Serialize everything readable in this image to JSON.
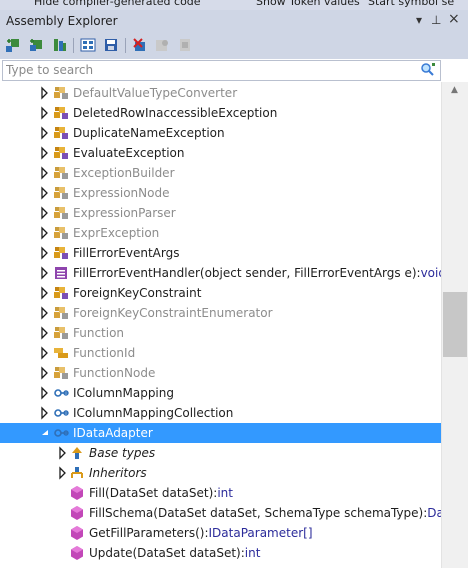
{
  "top_strip": {
    "items": [
      "Hide compiler-generated code",
      "Show Token values",
      "Start symbol se"
    ]
  },
  "window": {
    "title": "Assembly Explorer",
    "controls": {
      "dropdown": "▾",
      "pin": "⊥",
      "close": "×"
    }
  },
  "search": {
    "placeholder": "Type to search"
  },
  "colors": {
    "accent": "#3399ff",
    "titlebar": "#cfd6e5",
    "type_text": "#1e1e1e",
    "dim_text": "#8c8c8c",
    "return_type": "#2b2b9a"
  },
  "tree": {
    "rows": [
      {
        "label": "DefaultValueTypeConverter",
        "level": 0,
        "arrow": "collapsed",
        "icon": "class-gray-icon",
        "dim": true
      },
      {
        "label": "DeletedRowInaccessibleException",
        "level": 0,
        "arrow": "collapsed",
        "icon": "class-icon",
        "dim": false
      },
      {
        "label": "DuplicateNameException",
        "level": 0,
        "arrow": "collapsed",
        "icon": "class-icon",
        "dim": false
      },
      {
        "label": "EvaluateException",
        "level": 0,
        "arrow": "collapsed",
        "icon": "class-icon",
        "dim": false
      },
      {
        "label": "ExceptionBuilder",
        "level": 0,
        "arrow": "collapsed",
        "icon": "class-gray-icon",
        "dim": true
      },
      {
        "label": "ExpressionNode",
        "level": 0,
        "arrow": "collapsed",
        "icon": "class-gray-icon",
        "dim": true
      },
      {
        "label": "ExpressionParser",
        "level": 0,
        "arrow": "collapsed",
        "icon": "class-gray-icon",
        "dim": true
      },
      {
        "label": "ExprException",
        "level": 0,
        "arrow": "collapsed",
        "icon": "class-gray-icon",
        "dim": true
      },
      {
        "label": "FillErrorEventArgs",
        "level": 0,
        "arrow": "collapsed",
        "icon": "class-icon",
        "dim": false
      },
      {
        "label": "FillErrorEventHandler(object sender, FillErrorEventArgs e):",
        "ret": "void",
        "level": 0,
        "arrow": "collapsed",
        "icon": "delegate-icon",
        "dim": false
      },
      {
        "label": "ForeignKeyConstraint",
        "level": 0,
        "arrow": "collapsed",
        "icon": "class-icon",
        "dim": false
      },
      {
        "label": "ForeignKeyConstraintEnumerator",
        "level": 0,
        "arrow": "collapsed",
        "icon": "class-gray-icon",
        "dim": true
      },
      {
        "label": "Function",
        "level": 0,
        "arrow": "collapsed",
        "icon": "class-gray-icon",
        "dim": true
      },
      {
        "label": "FunctionId",
        "level": 0,
        "arrow": "collapsed",
        "icon": "enum-icon",
        "dim": true
      },
      {
        "label": "FunctionNode",
        "level": 0,
        "arrow": "collapsed",
        "icon": "class-gray-icon",
        "dim": true
      },
      {
        "label": "IColumnMapping",
        "level": 0,
        "arrow": "collapsed",
        "icon": "interface-icon",
        "dim": false
      },
      {
        "label": "IColumnMappingCollection",
        "level": 0,
        "arrow": "collapsed",
        "icon": "interface-icon",
        "dim": false
      },
      {
        "label": "IDataAdapter",
        "level": 0,
        "arrow": "expanded",
        "icon": "interface-icon",
        "dim": false,
        "selected": true
      },
      {
        "label": "Base types",
        "level": 1,
        "arrow": "collapsed",
        "icon": "base-types-icon",
        "dim": false,
        "italic": true
      },
      {
        "label": "Inheritors",
        "level": 1,
        "arrow": "collapsed",
        "icon": "inheritors-icon",
        "dim": false,
        "italic": true
      },
      {
        "label": "Fill(DataSet dataSet):",
        "ret": "int",
        "level": 2,
        "arrow": "none",
        "icon": "method-icon",
        "dim": false
      },
      {
        "label": "FillSchema(DataSet dataSet, SchemaType schemaType):",
        "ret": "DataTable[]",
        "level": 2,
        "arrow": "none",
        "icon": "method-icon",
        "dim": false
      },
      {
        "label": "GetFillParameters():",
        "ret": "IDataParameter[]",
        "level": 2,
        "arrow": "none",
        "icon": "method-icon",
        "dim": false
      },
      {
        "label": "Update(DataSet dataSet):",
        "ret": "int",
        "level": 2,
        "arrow": "none",
        "icon": "method-icon",
        "dim": false
      },
      {
        "label": "",
        "level": 2,
        "arrow": "none",
        "icon": "property-icon",
        "dim": false
      }
    ]
  }
}
